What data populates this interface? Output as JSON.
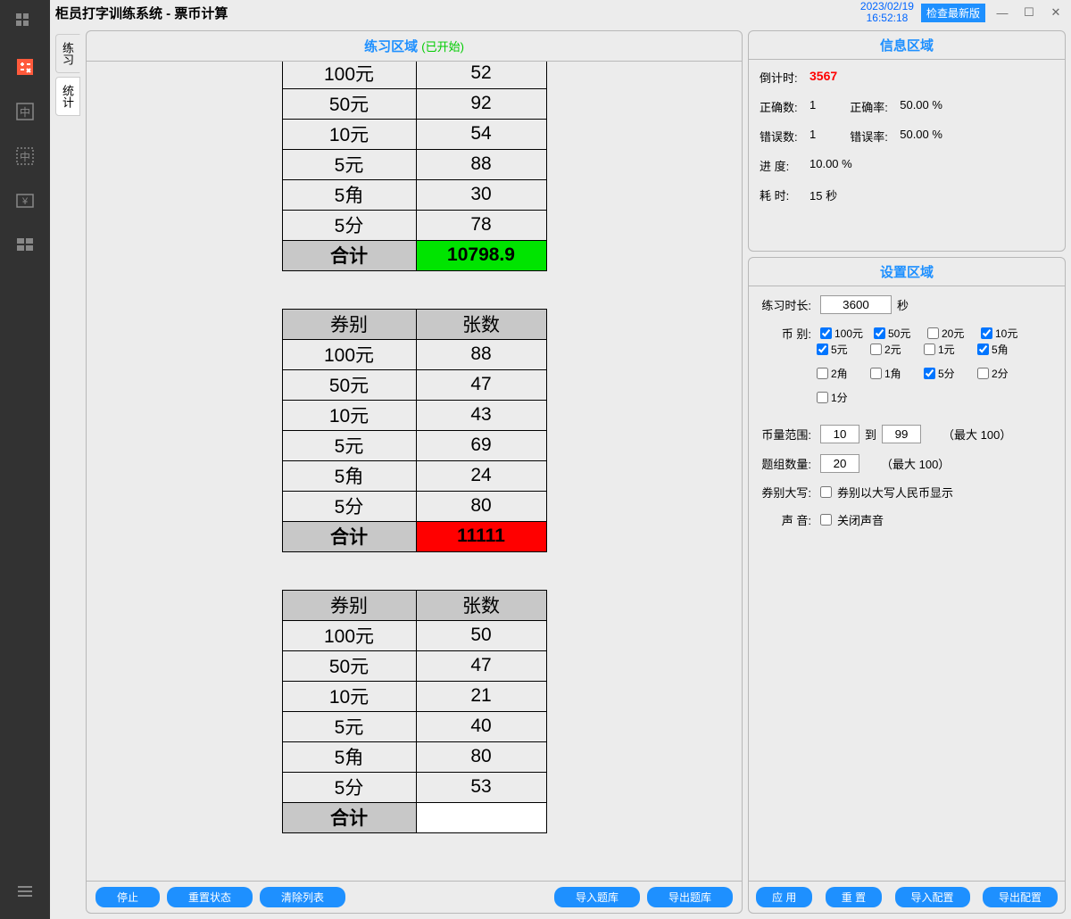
{
  "window": {
    "title": "柜员打字训练系统 - 票币计算",
    "date": "2023/02/19",
    "time": "16:52:18",
    "check_btn": "检查最新版"
  },
  "tabs": {
    "practice": "练习",
    "stats": "统计"
  },
  "practice": {
    "title": "练习区域",
    "status": "(已开始)",
    "col_denom": "券别",
    "col_count": "张数",
    "total_label": "合计",
    "footer": {
      "stop": "停止",
      "reset_state": "重置状态",
      "clear_list": "清除列表",
      "import": "导入题库",
      "export": "导出题库"
    },
    "tables": [
      {
        "rows": [
          {
            "d": "100元",
            "c": "52"
          },
          {
            "d": "50元",
            "c": "92"
          },
          {
            "d": "10元",
            "c": "54"
          },
          {
            "d": "5元",
            "c": "88"
          },
          {
            "d": "5角",
            "c": "30"
          },
          {
            "d": "5分",
            "c": "78"
          }
        ],
        "total": "10798.9",
        "total_class": "total-green",
        "show_header": false,
        "header_partial": true
      },
      {
        "rows": [
          {
            "d": "100元",
            "c": "88"
          },
          {
            "d": "50元",
            "c": "47"
          },
          {
            "d": "10元",
            "c": "43"
          },
          {
            "d": "5元",
            "c": "69"
          },
          {
            "d": "5角",
            "c": "24"
          },
          {
            "d": "5分",
            "c": "80"
          }
        ],
        "total": "11111",
        "total_class": "total-red",
        "show_header": true
      },
      {
        "rows": [
          {
            "d": "100元",
            "c": "50"
          },
          {
            "d": "50元",
            "c": "47"
          },
          {
            "d": "10元",
            "c": "21"
          },
          {
            "d": "5元",
            "c": "40"
          },
          {
            "d": "5角",
            "c": "80"
          },
          {
            "d": "5分",
            "c": "53"
          }
        ],
        "total": "",
        "total_class": "total-blank",
        "show_header": true
      }
    ]
  },
  "info": {
    "title": "信息区域",
    "countdown_label": "倒计时:",
    "countdown": "3567",
    "correct_count_label": "正确数:",
    "correct_count": "1",
    "correct_rate_label": "正确率:",
    "correct_rate": "50.00 %",
    "wrong_count_label": "错误数:",
    "wrong_count": "1",
    "wrong_rate_label": "错误率:",
    "wrong_rate": "50.00 %",
    "progress_label": "进   度:",
    "progress": "10.00 %",
    "elapsed_label": "耗   时:",
    "elapsed": "15 秒"
  },
  "settings": {
    "title": "设置区域",
    "duration_label": "练习时长:",
    "duration": "3600",
    "duration_unit": "秒",
    "denom_label": "币   别:",
    "denoms": [
      {
        "label": "100元",
        "checked": true
      },
      {
        "label": "50元",
        "checked": true
      },
      {
        "label": "20元",
        "checked": false
      },
      {
        "label": "10元",
        "checked": true
      },
      {
        "label": "5元",
        "checked": true
      },
      {
        "label": "2元",
        "checked": false
      },
      {
        "label": "1元",
        "checked": false
      },
      {
        "label": "5角",
        "checked": true
      },
      {
        "label": "2角",
        "checked": false
      },
      {
        "label": "1角",
        "checked": false
      },
      {
        "label": "5分",
        "checked": true
      },
      {
        "label": "2分",
        "checked": false
      },
      {
        "label": "1分",
        "checked": false
      }
    ],
    "range_label": "币量范围:",
    "range_from": "10",
    "range_to_label": "到",
    "range_to": "99",
    "range_max": "（最大 100）",
    "group_label": "题组数量:",
    "group_count": "20",
    "group_max": "（最大 100）",
    "upper_label": "券别大写:",
    "upper_cb": "券别以大写人民币显示",
    "sound_label": "声   音:",
    "sound_cb": "关闭声音",
    "footer": {
      "apply": "应 用",
      "reset": "重 置",
      "import": "导入配置",
      "export": "导出配置"
    }
  }
}
